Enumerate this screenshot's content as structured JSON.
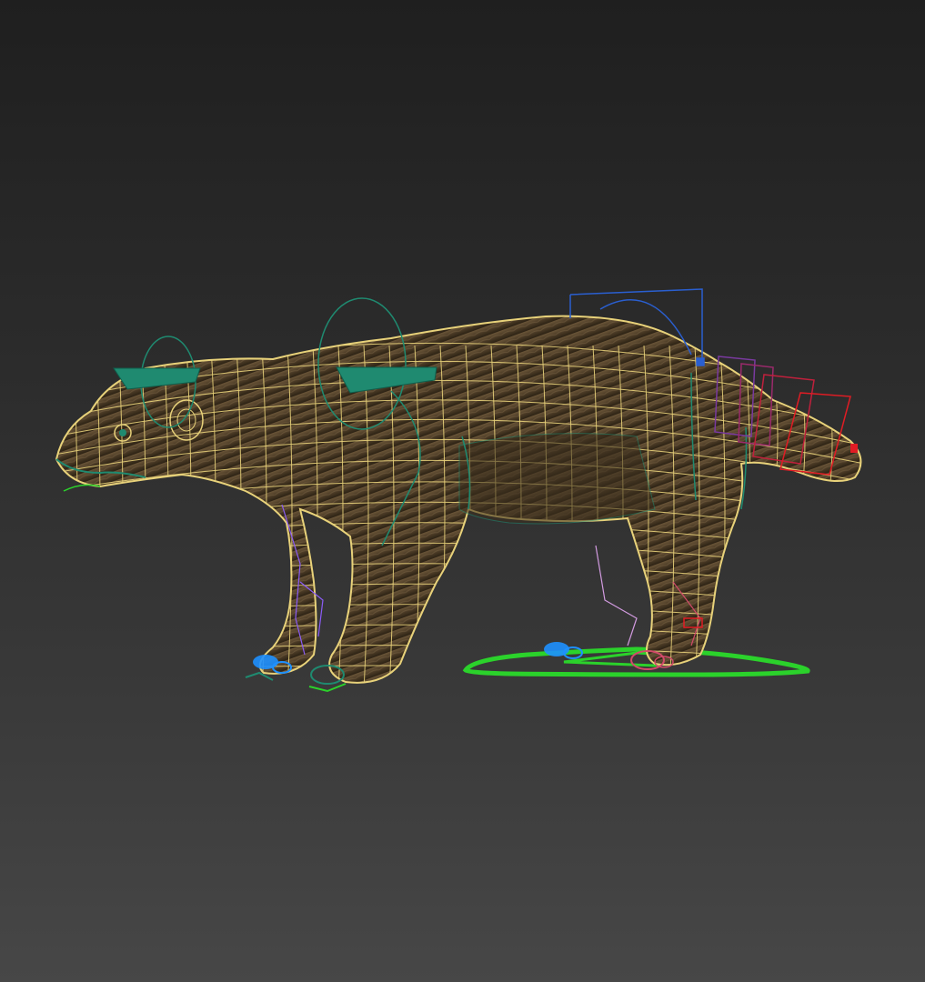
{
  "viewport": {
    "background_top": "#1f1f1f",
    "background_bottom": "#474747"
  },
  "model": {
    "mesh_wireframe_color": "#e8d27a",
    "fur_color": "#4a3a25",
    "bone_color": "#1f8a70",
    "spline_ik_color": "#2a5fd0",
    "tail_controls_color": "#e01c24",
    "ground_controller_color": "#2bd22b",
    "foot_controls_colors": [
      "#1e90ff",
      "#d24a6a",
      "#8b5cf6"
    ]
  }
}
